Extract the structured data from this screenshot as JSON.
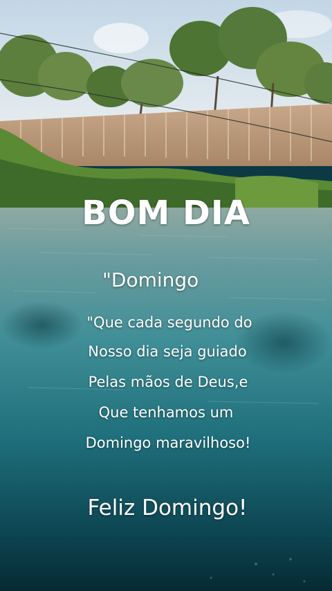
{
  "greeting": {
    "title": "BOM DIA",
    "subtitle": "\"Domingo"
  },
  "message": {
    "lines": [
      "\"Que cada segundo do",
      "Nosso dia seja guiado",
      "Pelas mãos de Deus,e",
      "Que tenhamos um",
      "Domingo maravilhoso!"
    ]
  },
  "closing": "Feliz Domingo!",
  "colors": {
    "text": "#ffffff",
    "water_light": "#5fa7ad",
    "water_deep": "#08323c",
    "sky": "#cfe0ea",
    "foliage": "#4f7d2f",
    "field": "#b99a7c"
  }
}
